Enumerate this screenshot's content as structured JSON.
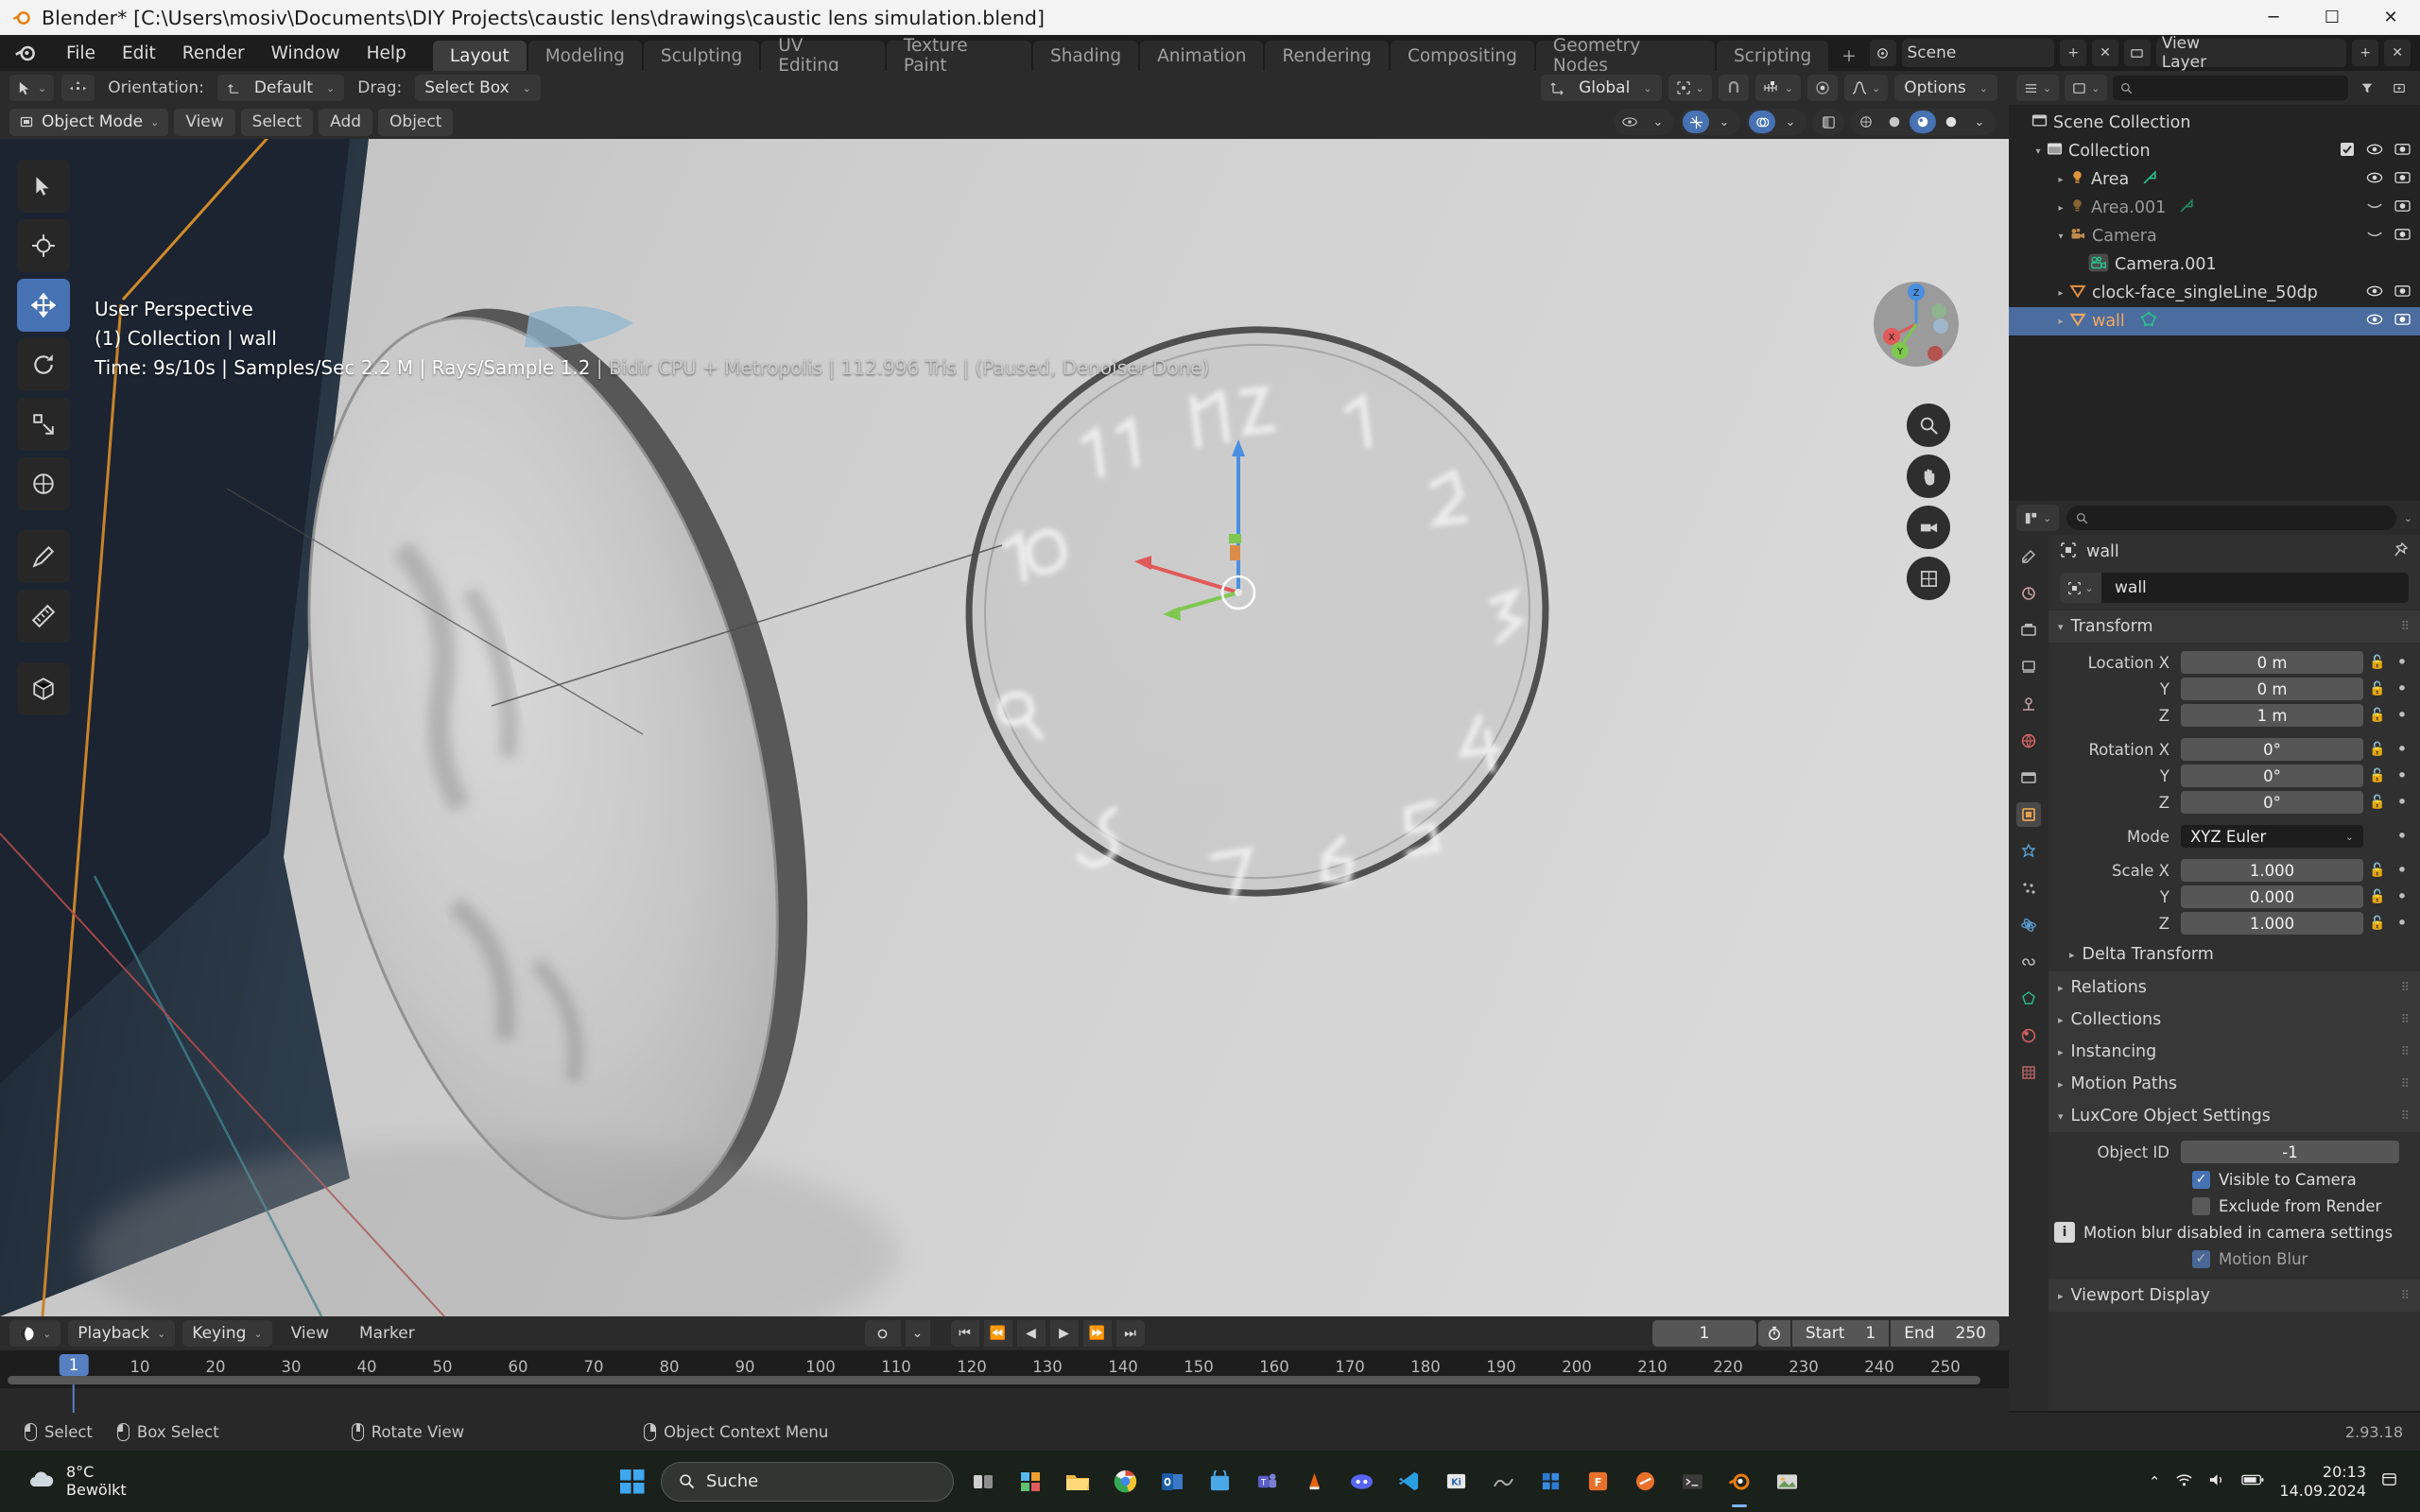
{
  "window": {
    "title": "Blender* [C:\\Users\\mosiv\\Documents\\DIY Projects\\caustic lens\\drawings\\caustic lens simulation.blend]",
    "minimize": "─",
    "maximize": "☐",
    "close": "✕"
  },
  "menubar": {
    "items": [
      "File",
      "Edit",
      "Render",
      "Window",
      "Help"
    ],
    "workspaces": [
      "Layout",
      "Modeling",
      "Sculpting",
      "UV Editing",
      "Texture Paint",
      "Shading",
      "Animation",
      "Rendering",
      "Compositing",
      "Geometry Nodes",
      "Scripting"
    ],
    "active_workspace": "Layout",
    "add_workspace": "+",
    "scene_label": "Scene",
    "view_layer_label": "View Layer"
  },
  "tool_header": {
    "orientation_label": "Orientation:",
    "orientation_value": "Default",
    "drag_label": "Drag:",
    "drag_value": "Select Box",
    "transform_orientation": "Global",
    "options_label": "Options"
  },
  "viewport_header": {
    "mode": "Object Mode",
    "menus": [
      "View",
      "Select",
      "Add",
      "Object"
    ]
  },
  "viewport": {
    "perspective": "User Perspective",
    "collection": "(1) Collection | wall",
    "stats_main": "Time: 9s/10s | Samples/Sec 2.2 M | Rays/Sample 1.2",
    "stats_faded": " | Bidir CPU + Metropolis | 112.996 Tris | (Paused, Denoiser Done)",
    "gizmo_axes": [
      "X",
      "Y",
      "Z"
    ]
  },
  "outliner": {
    "search_placeholder": "",
    "rows": [
      {
        "label": "Scene Collection",
        "icon": "collection-icon",
        "indent": 0,
        "tri": "",
        "selected": false,
        "dim": false,
        "checkbox": false,
        "eye": false,
        "camera": false
      },
      {
        "label": "Collection",
        "icon": "collection-icon",
        "indent": 1,
        "tri": "▾",
        "selected": false,
        "dim": false,
        "checkbox": true,
        "eye": true,
        "camera": true
      },
      {
        "label": "Area",
        "icon": "light-icon",
        "indent": 2,
        "tri": "▸",
        "selected": false,
        "dim": false,
        "checkbox": false,
        "eye": true,
        "camera": true
      },
      {
        "label": "Area.001",
        "icon": "light-icon",
        "indent": 2,
        "tri": "▸",
        "selected": false,
        "dim": true,
        "checkbox": false,
        "eye": "closed",
        "camera": true
      },
      {
        "label": "Camera",
        "icon": "camera-icon",
        "indent": 2,
        "tri": "▾",
        "selected": false,
        "dim": true,
        "checkbox": false,
        "eye": "closed",
        "camera": true
      },
      {
        "label": "Camera.001",
        "icon": "camera-data-icon",
        "indent": 3,
        "tri": "",
        "selected": false,
        "dim": false,
        "checkbox": false,
        "eye": false,
        "camera": false
      },
      {
        "label": "clock-face_singleLine_50dp",
        "icon": "mesh-icon",
        "indent": 2,
        "tri": "▸",
        "selected": false,
        "dim": false,
        "checkbox": false,
        "eye": true,
        "camera": true
      },
      {
        "label": "wall",
        "icon": "mesh-icon",
        "indent": 2,
        "tri": "▸",
        "selected": true,
        "dim": false,
        "checkbox": false,
        "eye": true,
        "camera": true
      }
    ]
  },
  "properties": {
    "search_placeholder": "",
    "breadcrumb": "wall",
    "object_name": "wall",
    "panels": {
      "transform": "Transform",
      "delta_transform": "Delta Transform",
      "relations": "Relations",
      "collections": "Collections",
      "instancing": "Instancing",
      "motion_paths": "Motion Paths",
      "luxcore": "LuxCore Object Settings",
      "viewport_display": "Viewport Display"
    },
    "transform_rows": [
      {
        "label": "Location X",
        "value": "0 m"
      },
      {
        "label": "Y",
        "value": "0 m"
      },
      {
        "label": "Z",
        "value": "1 m"
      },
      {
        "label": "Rotation X",
        "value": "0°"
      },
      {
        "label": "Y",
        "value": "0°"
      },
      {
        "label": "Z",
        "value": "0°"
      }
    ],
    "mode_label": "Mode",
    "mode_value": "XYZ Euler",
    "scale_rows": [
      {
        "label": "Scale X",
        "value": "1.000"
      },
      {
        "label": "Y",
        "value": "0.000"
      },
      {
        "label": "Z",
        "value": "1.000"
      }
    ],
    "luxcore_settings": {
      "object_id_label": "Object ID",
      "object_id_value": "-1",
      "visible_to_camera": "Visible to Camera",
      "exclude_from_render": "Exclude from Render",
      "motion_blur_info": "Motion blur disabled in camera settings",
      "motion_blur": "Motion Blur"
    }
  },
  "timeline": {
    "playback": "Playback",
    "keying": "Keying",
    "view": "View",
    "marker": "Marker",
    "current_frame": "1",
    "start_label": "Start",
    "start_value": "1",
    "end_label": "End",
    "end_value": "250",
    "playhead_frame": "1",
    "ticks": [
      1,
      10,
      20,
      30,
      40,
      50,
      60,
      70,
      80,
      90,
      100,
      110,
      120,
      130,
      140,
      150,
      160,
      170,
      180,
      190,
      200,
      210,
      220,
      230,
      240,
      250
    ]
  },
  "statusbar": {
    "items": [
      {
        "icon": "mouse-left-icon",
        "label": "Select"
      },
      {
        "icon": "mouse-left-drag-icon",
        "label": "Box Select"
      },
      {
        "icon": "mouse-middle-icon",
        "label": "Rotate View"
      },
      {
        "icon": "mouse-right-icon",
        "label": "Object Context Menu"
      }
    ],
    "version": "2.93.18"
  },
  "taskbar": {
    "weather_temp": "8°C",
    "weather_desc": "Bewölkt",
    "search_placeholder": "Suche",
    "clock_time": "20:13",
    "clock_date": "14.09.2024"
  },
  "colors": {
    "accent": "#4772b3",
    "selection": "#4b6c9e",
    "orange": "#f0a860",
    "axis_x": "#e05a5a",
    "axis_y": "#7ec850",
    "axis_z": "#4a8fe0"
  }
}
